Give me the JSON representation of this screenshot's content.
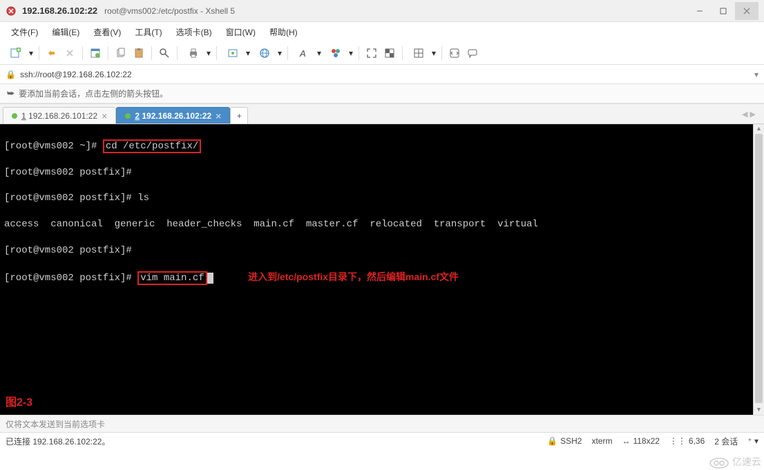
{
  "window": {
    "title": "192.168.26.102:22",
    "subtitle": "root@vms002:/etc/postfix - Xshell 5"
  },
  "menu": {
    "file": "文件(F)",
    "edit": "编辑(E)",
    "view": "查看(V)",
    "tools": "工具(T)",
    "tabs": "选项卡(B)",
    "window": "窗口(W)",
    "help": "帮助(H)"
  },
  "address": {
    "url": "ssh://root@192.168.26.102:22"
  },
  "hint": "要添加当前会话，点击左侧的箭头按钮。",
  "tabs": [
    {
      "num": "1",
      "label": "192.168.26.101:22",
      "active": false
    },
    {
      "num": "2",
      "label": "192.168.26.102:22",
      "active": true
    }
  ],
  "terminal": {
    "l1_prompt": "[root@vms002 ~]# ",
    "l1_cmd": "cd /etc/postfix/",
    "l2": "[root@vms002 postfix]#",
    "l3": "[root@vms002 postfix]# ls",
    "l4": "access  canonical  generic  header_checks  main.cf  master.cf  relocated  transport  virtual",
    "l5": "[root@vms002 postfix]#",
    "l6_prompt": "[root@vms002 postfix]# ",
    "l6_cmd": "vim main.cf",
    "annot": "进入到/etc/postfix目录下，然后编辑main.cf文件",
    "figlabel": "图2-3"
  },
  "sendbar": "仅将文本发送到当前选项卡",
  "status": {
    "conn": "已连接 192.168.26.102:22。",
    "proto": "SSH2",
    "term": "xterm",
    "size": "118x22",
    "pos": "6,36",
    "sessions": "2 会话"
  },
  "watermark": "亿速云"
}
